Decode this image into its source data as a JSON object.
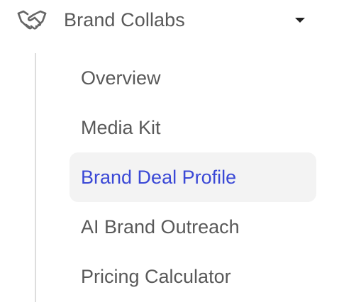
{
  "nav": {
    "group": {
      "title": "Brand Collabs",
      "icon": "handshake-icon",
      "expanded": true
    },
    "items": [
      {
        "label": "Overview",
        "active": false
      },
      {
        "label": "Media Kit",
        "active": false
      },
      {
        "label": "Brand Deal Profile",
        "active": true
      },
      {
        "label": "AI Brand Outreach",
        "active": false
      },
      {
        "label": "Pricing Calculator",
        "active": false
      }
    ]
  },
  "colors": {
    "text": "#595959",
    "active_text": "#3a48d6",
    "active_bg": "#f3f3f3",
    "rail": "#dddddd"
  }
}
